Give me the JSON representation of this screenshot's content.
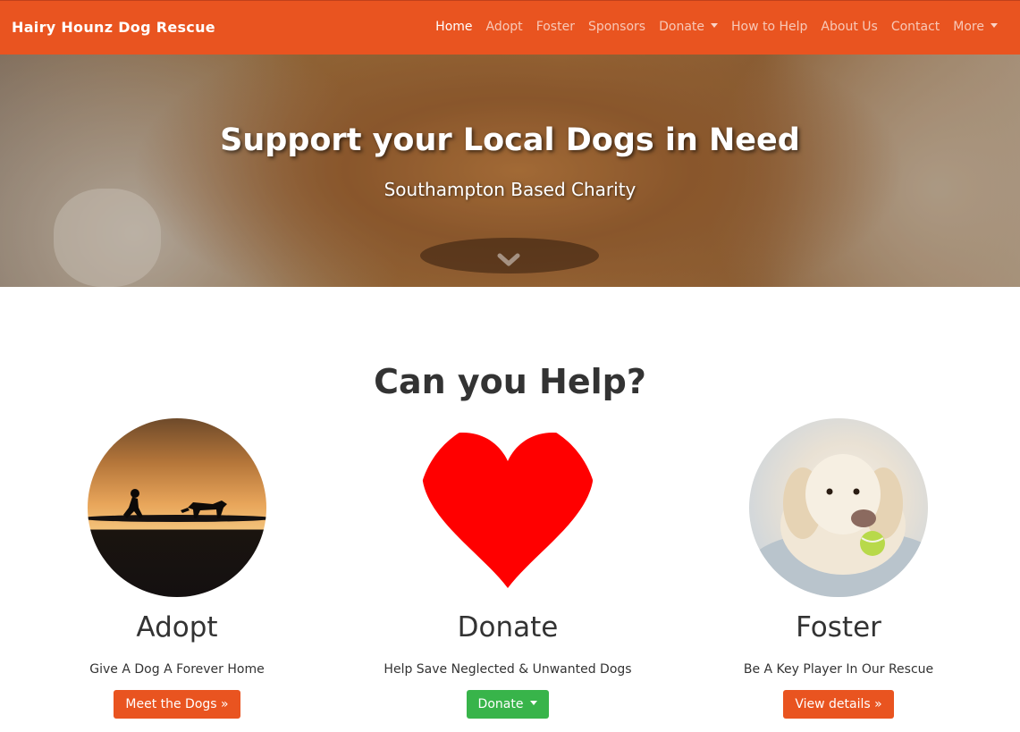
{
  "navbar": {
    "brand": "Hairy Hounz Dog Rescue",
    "links": [
      {
        "label": "Home"
      },
      {
        "label": "Adopt"
      },
      {
        "label": "Foster"
      },
      {
        "label": "Sponsors"
      },
      {
        "label": "Donate"
      },
      {
        "label": "How to Help"
      },
      {
        "label": "About Us"
      },
      {
        "label": "Contact"
      },
      {
        "label": "More"
      }
    ],
    "active": "Home"
  },
  "hero": {
    "title": "Support your Local Dogs in Need",
    "subtitle": "Southampton Based Charity"
  },
  "main": {
    "heading": "Can you Help?",
    "features": [
      {
        "title": "Adopt",
        "text": "Give A Dog A Forever Home",
        "button": "Meet the Dogs »"
      },
      {
        "title": "Donate",
        "text": "Help Save Neglected & Unwanted Dogs",
        "button": "Donate"
      },
      {
        "title": "Foster",
        "text": "Be A Key Player In Our Rescue",
        "button": "View details »"
      }
    ]
  },
  "colors": {
    "brand": "#e95420",
    "donate_button": "#38b44a",
    "heart": "#ff0000"
  }
}
